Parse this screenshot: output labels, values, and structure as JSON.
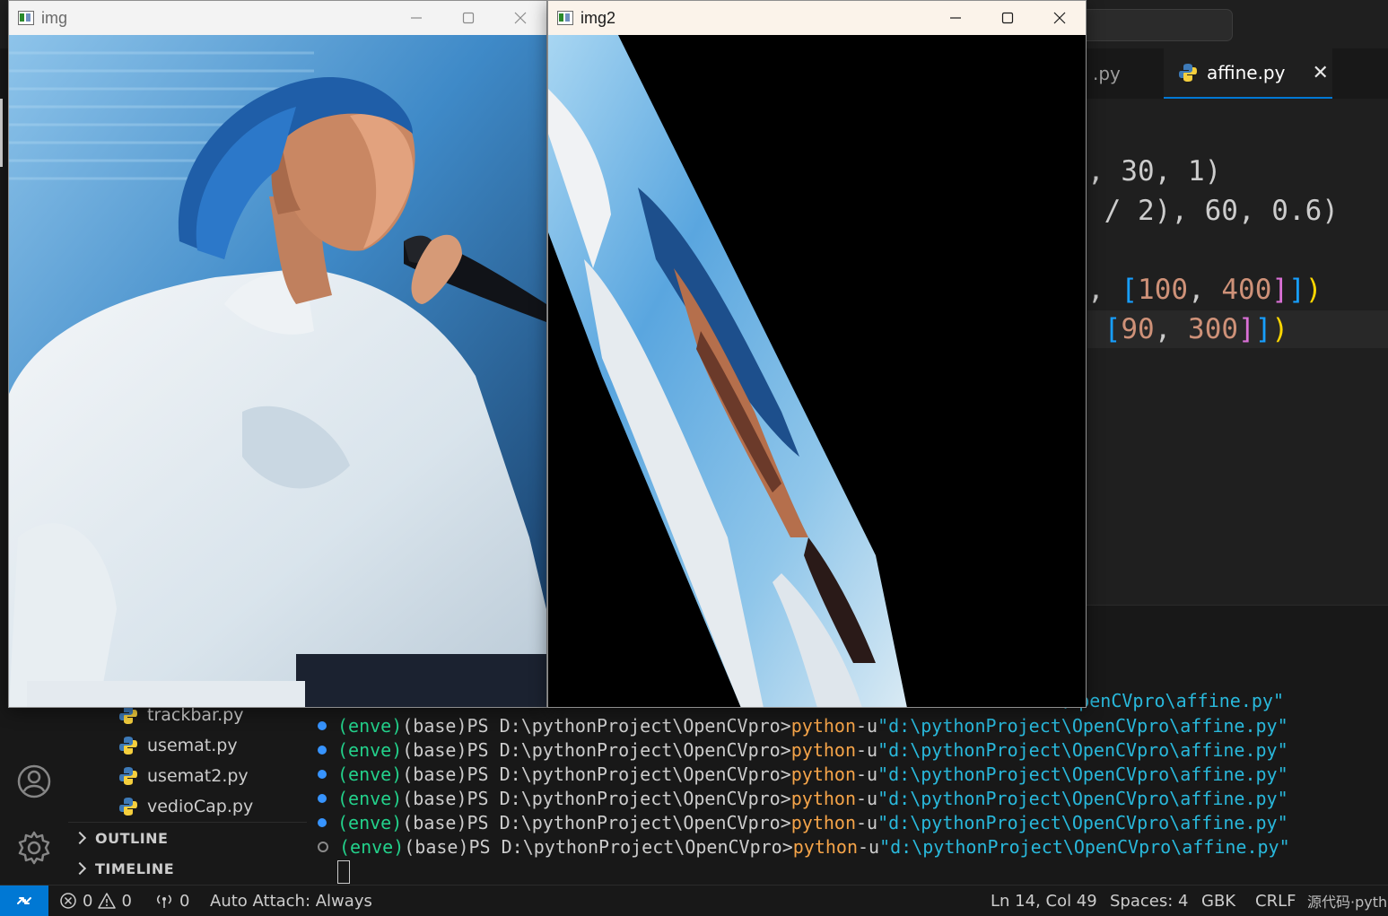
{
  "windows": [
    {
      "title": "img",
      "icon": "opencv-window-icon"
    },
    {
      "title": "img2",
      "icon": "opencv-window-icon"
    }
  ],
  "editor": {
    "tabs": [
      {
        "label": ".py",
        "active": false
      },
      {
        "label": "affine.py",
        "active": true
      }
    ],
    "code_fragments": [
      ", 30, 1)",
      " / 2), 60, 0.6)",
      ", [100, 400]])",
      " [90, 300]])"
    ]
  },
  "sidebar": {
    "files": [
      "trackbar.py",
      "usemat.py",
      "usemat2.py",
      "vedioCap.py"
    ],
    "sections": [
      "OUTLINE",
      "TIMELINE"
    ]
  },
  "terminal": {
    "partial_first_line": "ect\\OpenCVpro\\affine.py\"",
    "lines": [
      {
        "env": "(enve)",
        "base": "(base)",
        "prompt": "PS D:\\pythonProject\\OpenCVpro>",
        "cmd": "python",
        "flag": "-u",
        "path": "\"d:\\pythonProject\\OpenCVpro\\affine.py\""
      },
      {
        "env": "(enve)",
        "base": "(base)",
        "prompt": "PS D:\\pythonProject\\OpenCVpro>",
        "cmd": "python",
        "flag": "-u",
        "path": "\"d:\\pythonProject\\OpenCVpro\\affine.py\""
      },
      {
        "env": "(enve)",
        "base": "(base)",
        "prompt": "PS D:\\pythonProject\\OpenCVpro>",
        "cmd": "python",
        "flag": "-u",
        "path": "\"d:\\pythonProject\\OpenCVpro\\affine.py\""
      },
      {
        "env": "(enve)",
        "base": "(base)",
        "prompt": "PS D:\\pythonProject\\OpenCVpro>",
        "cmd": "python",
        "flag": "-u",
        "path": "\"d:\\pythonProject\\OpenCVpro\\affine.py\""
      },
      {
        "env": "(enve)",
        "base": "(base)",
        "prompt": "PS D:\\pythonProject\\OpenCVpro>",
        "cmd": "python",
        "flag": "-u",
        "path": "\"d:\\pythonProject\\OpenCVpro\\affine.py\""
      },
      {
        "env": "(enve)",
        "base": "(base)",
        "prompt": "PS D:\\pythonProject\\OpenCVpro>",
        "cmd": "python",
        "flag": "-u",
        "path": "\"d:\\pythonProject\\OpenCVpro\\affine.py\""
      }
    ]
  },
  "statusbar": {
    "errors": "0",
    "warnings": "0",
    "ports": "0",
    "auto_attach": "Auto Attach: Always",
    "position": "Ln 14, Col 49",
    "spaces": "Spaces: 4",
    "encoding": "GBK",
    "eol": "CRLF",
    "watermark": "源代码·python"
  },
  "colors": {
    "accent": "#0078d4",
    "terminal_green": "#23d18b",
    "terminal_yellow": "#f5a449",
    "terminal_cyan": "#29b8db",
    "number_orange": "#ce9178",
    "bracket_blue": "#179fff",
    "bracket_pink": "#da70d6"
  }
}
